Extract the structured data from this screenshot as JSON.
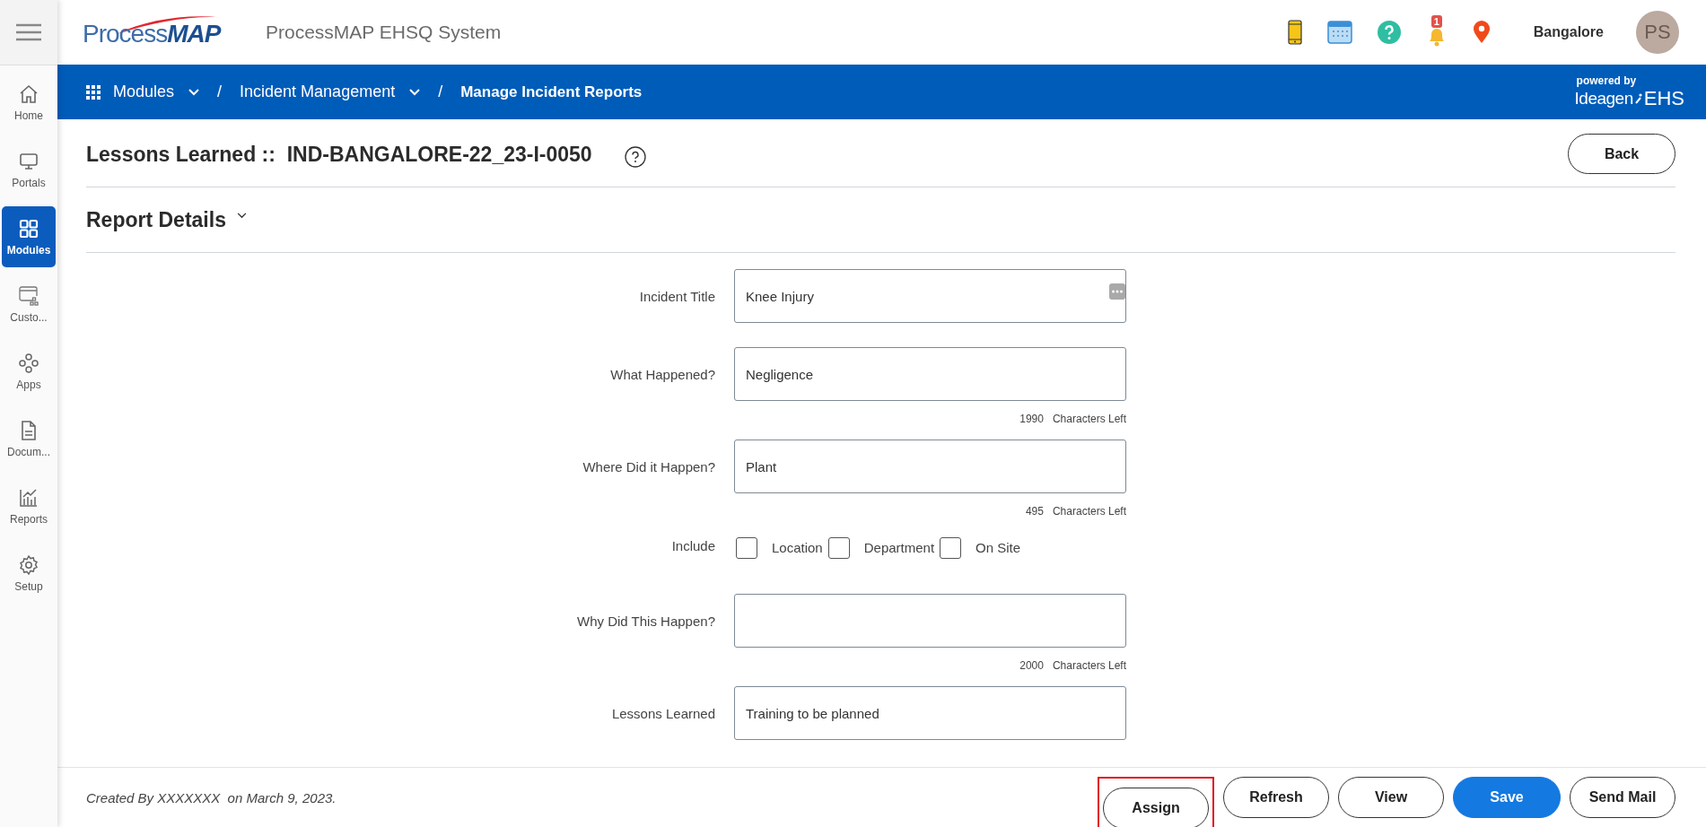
{
  "app": {
    "logo": "Process**MAP**",
    "title": "ProcessMAP EHSQ System",
    "notification_count": "1",
    "location": "Bangalore",
    "avatar_initials": "PS"
  },
  "sidebar": {
    "items": [
      {
        "label": "Home",
        "selected": false
      },
      {
        "label": "Portals",
        "selected": false
      },
      {
        "label": "Modules",
        "selected": true
      },
      {
        "label": "Custo...",
        "selected": false
      },
      {
        "label": "Apps",
        "selected": false
      },
      {
        "label": "Docum...",
        "selected": false
      },
      {
        "label": "Reports",
        "selected": false
      },
      {
        "label": "Setup",
        "selected": false
      }
    ]
  },
  "breadcrumb": [
    {
      "label": "Modules",
      "dropdown": true,
      "current": false
    },
    {
      "separator": "/",
      "label": "Incident Management",
      "dropdown": true,
      "current": false
    },
    {
      "separator": "/",
      "label": "Manage Incident Reports",
      "dropdown": false,
      "current": true
    }
  ],
  "brand": {
    "powered_by": "powered by",
    "name": "Ideagen",
    "product": "EHS"
  },
  "page": {
    "title": "Lessons Learned ::  IND-BANGALORE-22_23-I-0050",
    "back": "Back",
    "section": "Report Details"
  },
  "form": {
    "rows": [
      {
        "kind": "field",
        "label": "Incident Title",
        "value": "Knee Injury",
        "more_button": true
      },
      {
        "kind": "field",
        "label": "What Happened?",
        "value": "Negligence",
        "more_button": false,
        "count": "1990",
        "count_label": "Characters Left"
      },
      {
        "kind": "field",
        "label": "Where Did it Happen?",
        "value": "Plant",
        "more_button": false,
        "count": "495",
        "count_label": "Characters Left"
      },
      {
        "kind": "checkboxes",
        "label": "Include",
        "options": [
          {
            "label": "Location",
            "checked": false
          },
          {
            "label": "Department",
            "checked": false
          },
          {
            "label": "On Site",
            "checked": false
          }
        ]
      },
      {
        "kind": "field",
        "label": "Why Did This Happen?",
        "value": "",
        "more_button": false,
        "count": "2000",
        "count_label": "Characters Left"
      },
      {
        "kind": "field",
        "label": "Lessons Learned",
        "value": "Training to be planned",
        "more_button": false
      }
    ]
  },
  "footer": {
    "created": "Created By XXXXXXX  on March 9, 2023.",
    "buttons": [
      {
        "label": "Assign",
        "kind": "outline",
        "highlighted": true
      },
      {
        "label": "Refresh",
        "kind": "outline",
        "highlighted": false
      },
      {
        "label": "View",
        "kind": "outline",
        "highlighted": false
      },
      {
        "label": "Save",
        "kind": "primary",
        "highlighted": false
      },
      {
        "label": "Send Mail",
        "kind": "outline",
        "highlighted": false
      }
    ]
  }
}
